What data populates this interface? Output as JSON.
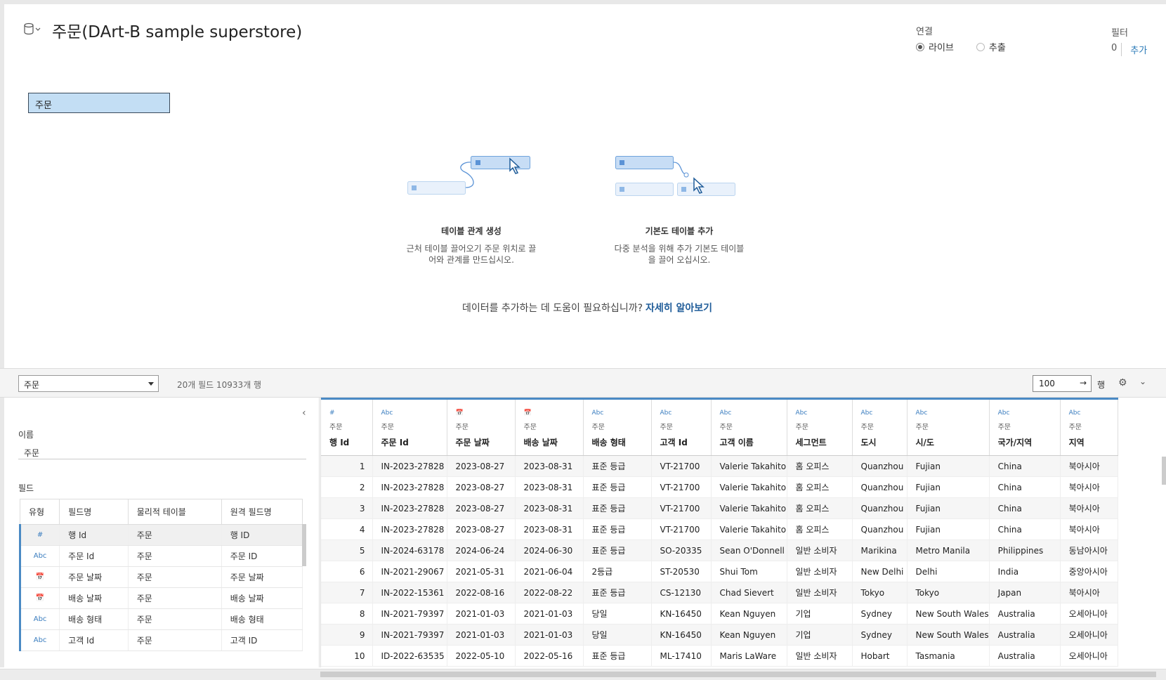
{
  "header": {
    "datasource_title": "주문(DArt-B sample superstore)",
    "connection_label": "연결",
    "connection_live": "라이브",
    "connection_extract": "추출",
    "filter_label": "필터",
    "filter_count": "0",
    "filter_add": "추가"
  },
  "canvas": {
    "table_chip": "주문",
    "relation_title": "테이블 관계 생성",
    "relation_desc_1": "근처 테이블 끌어오기 주문 위치로 끌",
    "relation_desc_2": "어와 관계를 만드십시오.",
    "base_title": "기본도 테이블 추가",
    "base_desc_1": "다중 분석을 위해 추가 기본도 테이블",
    "base_desc_2": "을 끌어 오십시오.",
    "help_text": "데이터를 추가하는 데 도움이 필요하십니까?",
    "help_link": "자세히 알아보기"
  },
  "toolbar": {
    "table_select": "주문",
    "counts": "20개 필드 10933개 행",
    "rows_value": "100",
    "rows_label": "행"
  },
  "left_panel": {
    "name_label": "이름",
    "name_value": "주문",
    "fields_label": "필드",
    "columns": [
      "유형",
      "필드명",
      "물리적 테이블",
      "원격 필드명"
    ],
    "rows": [
      {
        "type": "#",
        "name": "행 Id",
        "table": "주문",
        "remote": "행 ID"
      },
      {
        "type": "Abc",
        "name": "주문 Id",
        "table": "주문",
        "remote": "주문 ID"
      },
      {
        "type": "📅",
        "name": "주문 날짜",
        "table": "주문",
        "remote": "주문 날짜"
      },
      {
        "type": "📅",
        "name": "배송 날짜",
        "table": "주문",
        "remote": "배송 날짜"
      },
      {
        "type": "Abc",
        "name": "배송 형태",
        "table": "주문",
        "remote": "배송 형태"
      },
      {
        "type": "Abc",
        "name": "고객 Id",
        "table": "주문",
        "remote": "고객 ID"
      }
    ]
  },
  "grid": {
    "columns": [
      {
        "type": "#",
        "table": "주문",
        "name": "행 Id"
      },
      {
        "type": "Abc",
        "table": "주문",
        "name": "주문 Id"
      },
      {
        "type": "📅",
        "table": "주문",
        "name": "주문 날짜"
      },
      {
        "type": "📅",
        "table": "주문",
        "name": "배송 날짜"
      },
      {
        "type": "Abc",
        "table": "주문",
        "name": "배송 형태"
      },
      {
        "type": "Abc",
        "table": "주문",
        "name": "고객 Id"
      },
      {
        "type": "Abc",
        "table": "주문",
        "name": "고객 이름"
      },
      {
        "type": "Abc",
        "table": "주문",
        "name": "세그먼트"
      },
      {
        "type": "Abc",
        "table": "주문",
        "name": "도시"
      },
      {
        "type": "Abc",
        "table": "주문",
        "name": "시/도"
      },
      {
        "type": "Abc",
        "table": "주문",
        "name": "국가/지역"
      },
      {
        "type": "Abc",
        "table": "주문",
        "name": "지역"
      }
    ],
    "rows": [
      [
        "1",
        "IN-2023-27828",
        "2023-08-27",
        "2023-08-31",
        "표준 등급",
        "VT-21700",
        "Valerie Takahito",
        "홈 오피스",
        "Quanzhou",
        "Fujian",
        "China",
        "북아시아"
      ],
      [
        "2",
        "IN-2023-27828",
        "2023-08-27",
        "2023-08-31",
        "표준 등급",
        "VT-21700",
        "Valerie Takahito",
        "홈 오피스",
        "Quanzhou",
        "Fujian",
        "China",
        "북아시아"
      ],
      [
        "3",
        "IN-2023-27828",
        "2023-08-27",
        "2023-08-31",
        "표준 등급",
        "VT-21700",
        "Valerie Takahito",
        "홈 오피스",
        "Quanzhou",
        "Fujian",
        "China",
        "북아시아"
      ],
      [
        "4",
        "IN-2023-27828",
        "2023-08-27",
        "2023-08-31",
        "표준 등급",
        "VT-21700",
        "Valerie Takahito",
        "홈 오피스",
        "Quanzhou",
        "Fujian",
        "China",
        "북아시아"
      ],
      [
        "5",
        "IN-2024-63178",
        "2024-06-24",
        "2024-06-30",
        "표준 등급",
        "SO-20335",
        "Sean O'Donnell",
        "일반 소비자",
        "Marikina",
        "Metro Manila",
        "Philippines",
        "동남아시아"
      ],
      [
        "6",
        "IN-2021-29067",
        "2021-05-31",
        "2021-06-04",
        "2등급",
        "ST-20530",
        "Shui Tom",
        "일반 소비자",
        "New Delhi",
        "Delhi",
        "India",
        "중앙아시아"
      ],
      [
        "7",
        "IN-2022-15361",
        "2022-08-16",
        "2022-08-22",
        "표준 등급",
        "CS-12130",
        "Chad Sievert",
        "일반 소비자",
        "Tokyo",
        "Tokyo",
        "Japan",
        "북아시아"
      ],
      [
        "8",
        "IN-2021-79397",
        "2021-01-03",
        "2021-01-03",
        "당일",
        "KN-16450",
        "Kean Nguyen",
        "기업",
        "Sydney",
        "New South Wales",
        "Australia",
        "오세아니아"
      ],
      [
        "9",
        "IN-2021-79397",
        "2021-01-03",
        "2021-01-03",
        "당일",
        "KN-16450",
        "Kean Nguyen",
        "기업",
        "Sydney",
        "New South Wales",
        "Australia",
        "오세아니아"
      ],
      [
        "10",
        "ID-2022-63535",
        "2022-05-10",
        "2022-05-16",
        "표준 등급",
        "ML-17410",
        "Maris LaWare",
        "일반 소비자",
        "Hobart",
        "Tasmania",
        "Australia",
        "오세아니아"
      ]
    ]
  }
}
